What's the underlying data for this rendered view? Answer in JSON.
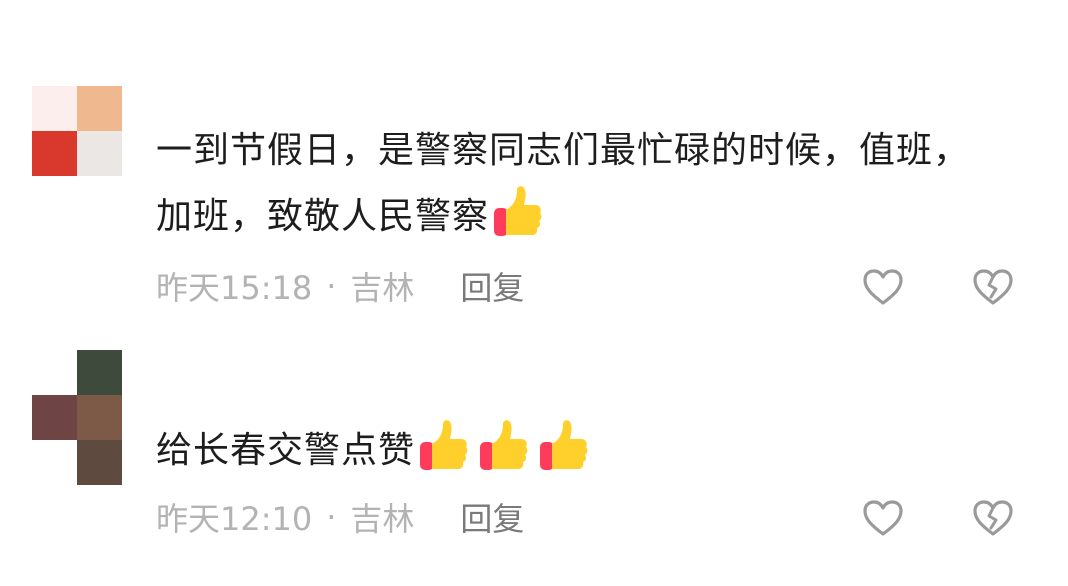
{
  "comments": [
    {
      "text": "一到节假日，是警察同志们最忙碌的时候，值班，加班，致敬人民警察",
      "emoji_count": 1,
      "time": "昨天15:18",
      "separator": "·",
      "location": "吉林",
      "reply_label": "回复"
    },
    {
      "text": "给长春交警点赞",
      "emoji_count": 3,
      "time": "昨天12:10",
      "separator": "·",
      "location": "吉林",
      "reply_label": "回复"
    }
  ],
  "icons": {
    "like": "heart-outline-icon",
    "dislike": "broken-heart-outline-icon",
    "emoji": "thumbs-up-emoji"
  },
  "colors": {
    "meta_text": "#b3b3b3",
    "reply_text": "#7a7a7a",
    "icon_stroke": "#9a9a9a"
  }
}
